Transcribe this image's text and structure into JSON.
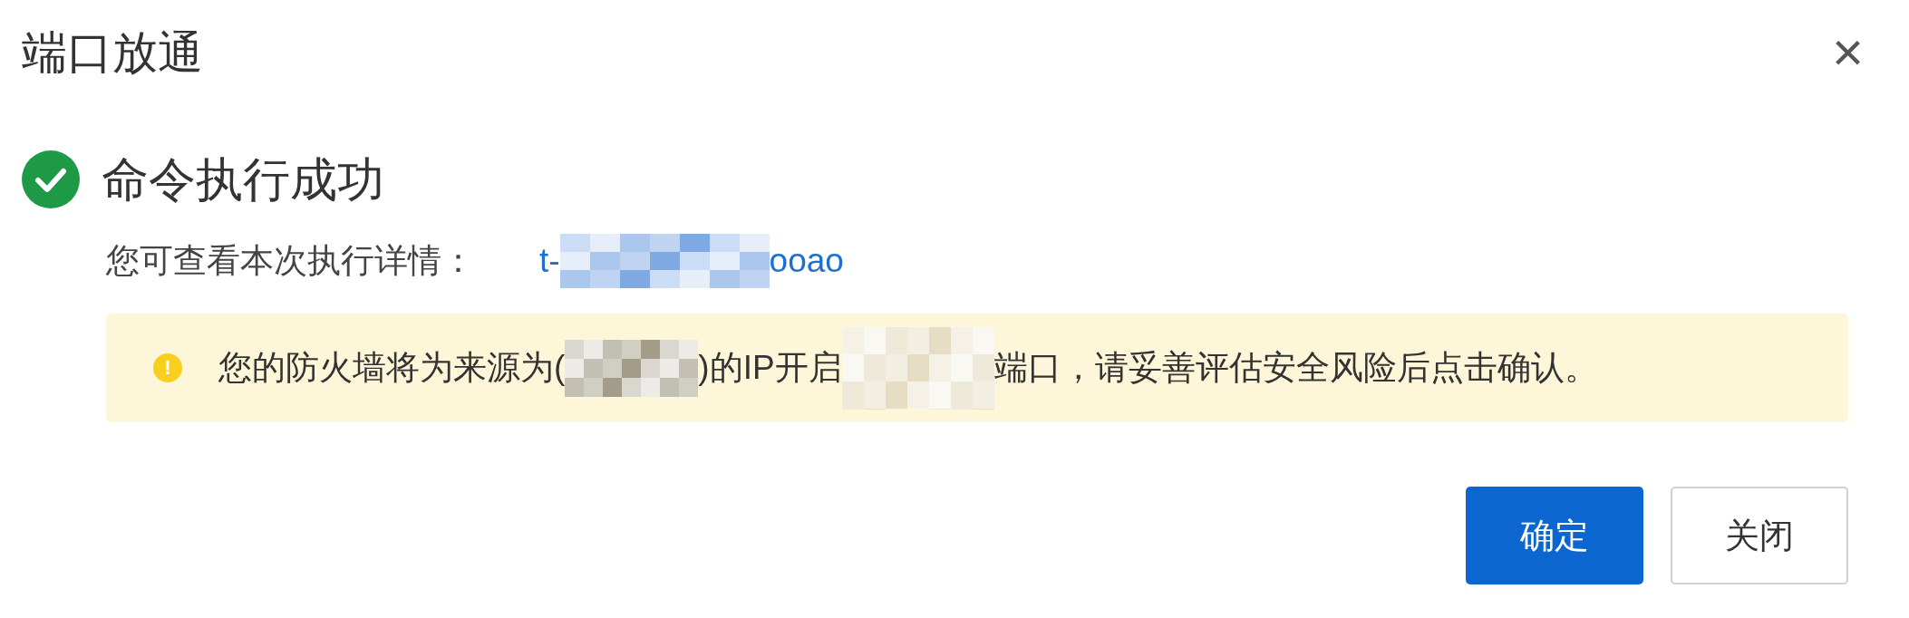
{
  "dialog": {
    "title": "端口放通",
    "close": "×"
  },
  "result": {
    "success": true,
    "heading": "命令执行成功"
  },
  "details": {
    "label": "您可查看本次执行详情：",
    "link": [
      {
        "kind": "text",
        "text": "t-"
      },
      {
        "kind": "redacted",
        "color": "#7ea9e3"
      },
      {
        "kind": "text",
        "text": "ooao"
      }
    ]
  },
  "warning": {
    "icon": "!",
    "segments": [
      {
        "kind": "text",
        "text": "您的防火墙将为来源为("
      },
      {
        "kind": "redacted",
        "color": "#a39c89"
      },
      {
        "kind": "text",
        "text": ")的IP开启"
      },
      {
        "kind": "redacted",
        "color": "#e5ddc4"
      },
      {
        "kind": "text",
        "text": "端口，请妥善评估安全风险后点击确认。"
      }
    ]
  },
  "buttons": [
    {
      "label": "确定",
      "primary": true
    },
    {
      "label": "关闭",
      "primary": false
    }
  ]
}
